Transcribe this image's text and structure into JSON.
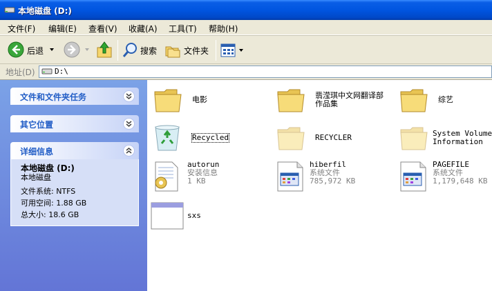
{
  "window": {
    "title": "本地磁盘 (D:)"
  },
  "menu": [
    "文件(F)",
    "编辑(E)",
    "查看(V)",
    "收藏(A)",
    "工具(T)",
    "帮助(H)"
  ],
  "toolbar": {
    "back": "后退",
    "search": "搜索",
    "folders": "文件夹"
  },
  "address": {
    "label": "地址(D)",
    "value": "D:\\"
  },
  "tasks": {
    "file_tasks": "文件和文件夹任务",
    "other_places": "其它位置",
    "details": {
      "header": "详细信息",
      "name": "本地磁盘 (D:)",
      "type": "本地磁盘",
      "fs": "文件系统: NTFS",
      "free": "可用空间: 1.88 GB",
      "total": "总大小: 18.6 GB"
    }
  },
  "items": [
    {
      "name": "电影",
      "kind": "folder"
    },
    {
      "name": "翡滢琪中文网翻译部",
      "name2": "作品集",
      "kind": "folder"
    },
    {
      "name": "综艺",
      "kind": "folder"
    },
    {
      "name": "Recycled",
      "kind": "recycle"
    },
    {
      "name": "RECYCLER",
      "kind": "folder-faded"
    },
    {
      "name": "System Volume",
      "name2": "Information",
      "kind": "folder-faded"
    },
    {
      "name": "autorun",
      "type": "安装信息",
      "size": "1 KB",
      "kind": "setup-file"
    },
    {
      "name": "hiberfil",
      "type": "系统文件",
      "size": "785,972 KB",
      "kind": "system-file"
    },
    {
      "name": "PAGEFILE",
      "type": "系统文件",
      "size": "1,179,648 KB",
      "kind": "system-file"
    },
    {
      "name": "sxs",
      "kind": "window-file"
    }
  ],
  "colors": {
    "titlebar": "#0055e0",
    "leftpane": "#6f8ce0",
    "panel_header_text": "#215dc6"
  }
}
